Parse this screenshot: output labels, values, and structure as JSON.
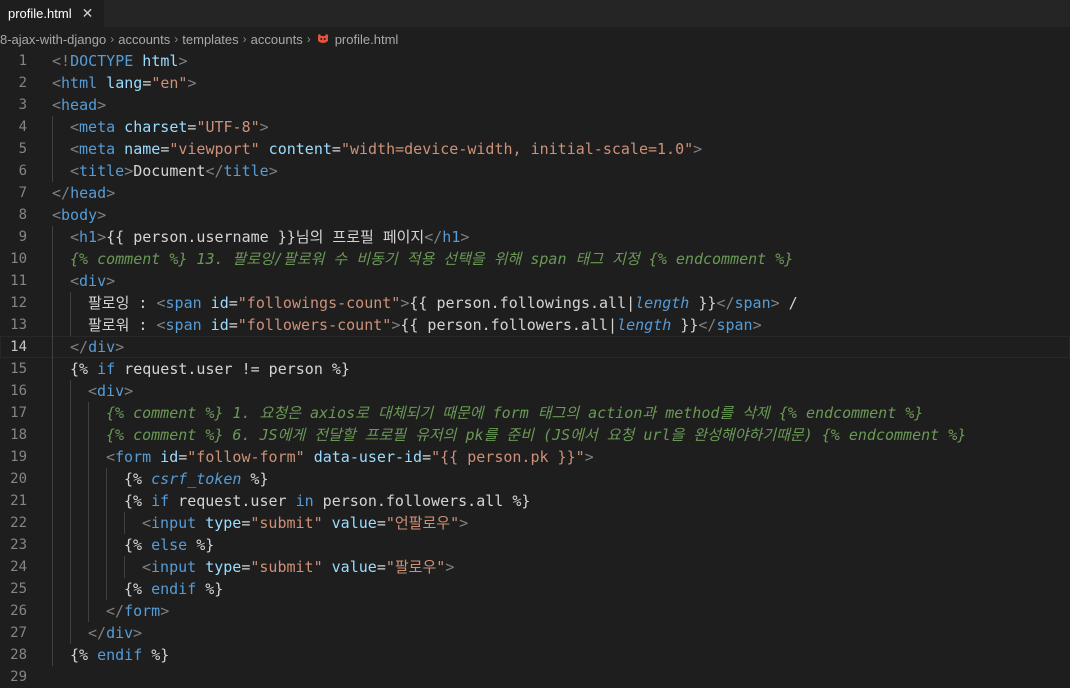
{
  "tab": {
    "name": "profile.html",
    "close": "✕"
  },
  "breadcrumb": [
    "8-ajax-with-django",
    "accounts",
    "templates",
    "accounts",
    "profile.html"
  ],
  "active_line": 14,
  "lines": [
    {
      "n": "1",
      "indent": 0,
      "tokens": [
        [
          "b",
          "<!"
        ],
        [
          "k",
          "DOCTYPE"
        ],
        [
          "a",
          " html"
        ],
        [
          "b",
          ">"
        ]
      ]
    },
    {
      "n": "2",
      "indent": 0,
      "tokens": [
        [
          "b",
          "<"
        ],
        [
          "k",
          "html"
        ],
        [
          "a",
          " lang"
        ],
        [
          "t",
          "="
        ],
        [
          "s",
          "\"en\""
        ],
        [
          "b",
          ">"
        ]
      ]
    },
    {
      "n": "3",
      "indent": 0,
      "tokens": [
        [
          "b",
          "<"
        ],
        [
          "k",
          "head"
        ],
        [
          "b",
          ">"
        ]
      ]
    },
    {
      "n": "4",
      "indent": 1,
      "tokens": [
        [
          "b",
          "<"
        ],
        [
          "k",
          "meta"
        ],
        [
          "a",
          " charset"
        ],
        [
          "t",
          "="
        ],
        [
          "s",
          "\"UTF-8\""
        ],
        [
          "b",
          ">"
        ]
      ]
    },
    {
      "n": "5",
      "indent": 1,
      "tokens": [
        [
          "b",
          "<"
        ],
        [
          "k",
          "meta"
        ],
        [
          "a",
          " name"
        ],
        [
          "t",
          "="
        ],
        [
          "s",
          "\"viewport\""
        ],
        [
          "a",
          " content"
        ],
        [
          "t",
          "="
        ],
        [
          "s",
          "\"width=device-width, initial-scale=1.0\""
        ],
        [
          "b",
          ">"
        ]
      ]
    },
    {
      "n": "6",
      "indent": 1,
      "tokens": [
        [
          "b",
          "<"
        ],
        [
          "k",
          "title"
        ],
        [
          "b",
          ">"
        ],
        [
          "t",
          "Document"
        ],
        [
          "b",
          "</"
        ],
        [
          "k",
          "title"
        ],
        [
          "b",
          ">"
        ]
      ]
    },
    {
      "n": "7",
      "indent": 0,
      "tokens": [
        [
          "b",
          "</"
        ],
        [
          "k",
          "head"
        ],
        [
          "b",
          ">"
        ]
      ]
    },
    {
      "n": "8",
      "indent": 0,
      "tokens": [
        [
          "b",
          "<"
        ],
        [
          "k",
          "body"
        ],
        [
          "b",
          ">"
        ]
      ]
    },
    {
      "n": "9",
      "indent": 1,
      "tokens": [
        [
          "b",
          "<"
        ],
        [
          "k",
          "h1"
        ],
        [
          "b",
          ">"
        ],
        [
          "t",
          "{{ person.username }}님의 프로필 페이지"
        ],
        [
          "b",
          "</"
        ],
        [
          "k",
          "h1"
        ],
        [
          "b",
          ">"
        ]
      ]
    },
    {
      "n": "10",
      "indent": 1,
      "tokens": [
        [
          "c",
          "{% comment %} 13. 팔로잉/팔로워 수 비동기 적용 선택을 위해 span 태그 지정 {% endcomment %}"
        ]
      ]
    },
    {
      "n": "11",
      "indent": 1,
      "tokens": [
        [
          "b",
          "<"
        ],
        [
          "k",
          "div"
        ],
        [
          "b",
          ">"
        ]
      ]
    },
    {
      "n": "12",
      "indent": 2,
      "tokens": [
        [
          "t",
          "팔로잉 : "
        ],
        [
          "b",
          "<"
        ],
        [
          "k",
          "span"
        ],
        [
          "a",
          " id"
        ],
        [
          "t",
          "="
        ],
        [
          "s",
          "\"followings-count\""
        ],
        [
          "b",
          ">"
        ],
        [
          "t",
          "{{ person.followings.all|"
        ],
        [
          "i",
          "length"
        ],
        [
          "t",
          " }}"
        ],
        [
          "b",
          "</"
        ],
        [
          "k",
          "span"
        ],
        [
          "b",
          ">"
        ],
        [
          "t",
          " /"
        ]
      ]
    },
    {
      "n": "13",
      "indent": 2,
      "tokens": [
        [
          "t",
          "팔로워 : "
        ],
        [
          "b",
          "<"
        ],
        [
          "k",
          "span"
        ],
        [
          "a",
          " id"
        ],
        [
          "t",
          "="
        ],
        [
          "s",
          "\"followers-count\""
        ],
        [
          "b",
          ">"
        ],
        [
          "t",
          "{{ person.followers.all|"
        ],
        [
          "i",
          "length"
        ],
        [
          "t",
          " }}"
        ],
        [
          "b",
          "</"
        ],
        [
          "k",
          "span"
        ],
        [
          "b",
          ">"
        ]
      ]
    },
    {
      "n": "14",
      "indent": 1,
      "tokens": [
        [
          "b",
          "</"
        ],
        [
          "k",
          "div"
        ],
        [
          "b",
          ">"
        ]
      ]
    },
    {
      "n": "15",
      "indent": 1,
      "tokens": [
        [
          "t",
          "{% "
        ],
        [
          "d",
          "if"
        ],
        [
          "t",
          " request.user != person %}"
        ]
      ]
    },
    {
      "n": "16",
      "indent": 2,
      "tokens": [
        [
          "b",
          "<"
        ],
        [
          "k",
          "div"
        ],
        [
          "b",
          ">"
        ]
      ]
    },
    {
      "n": "17",
      "indent": 3,
      "tokens": [
        [
          "c",
          "{% comment %} 1. 요청은 axios로 대체되기 때문에 form 태그의 action과 method를 삭제 {% endcomment %}"
        ]
      ]
    },
    {
      "n": "18",
      "indent": 3,
      "tokens": [
        [
          "c",
          "{% comment %} 6. JS에게 전달할 프로필 유저의 pk를 준비 (JS에서 요청 url을 완성해야하기때문) {% endcomment %}"
        ]
      ]
    },
    {
      "n": "19",
      "indent": 3,
      "tokens": [
        [
          "b",
          "<"
        ],
        [
          "k",
          "form"
        ],
        [
          "a",
          " id"
        ],
        [
          "t",
          "="
        ],
        [
          "s",
          "\"follow-form\""
        ],
        [
          "a",
          " data-user-id"
        ],
        [
          "t",
          "="
        ],
        [
          "s",
          "\"{{ person.pk }}\""
        ],
        [
          "b",
          ">"
        ]
      ]
    },
    {
      "n": "20",
      "indent": 4,
      "tokens": [
        [
          "t",
          "{% "
        ],
        [
          "i",
          "csrf_token"
        ],
        [
          "t",
          " %}"
        ]
      ]
    },
    {
      "n": "21",
      "indent": 4,
      "tokens": [
        [
          "t",
          "{% "
        ],
        [
          "d",
          "if"
        ],
        [
          "t",
          " request.user "
        ],
        [
          "d",
          "in"
        ],
        [
          "t",
          " person.followers.all %}"
        ]
      ]
    },
    {
      "n": "22",
      "indent": 5,
      "tokens": [
        [
          "b",
          "<"
        ],
        [
          "k",
          "input"
        ],
        [
          "a",
          " type"
        ],
        [
          "t",
          "="
        ],
        [
          "s",
          "\"submit\""
        ],
        [
          "a",
          " value"
        ],
        [
          "t",
          "="
        ],
        [
          "s",
          "\"언팔로우\""
        ],
        [
          "b",
          ">"
        ]
      ]
    },
    {
      "n": "23",
      "indent": 4,
      "tokens": [
        [
          "t",
          "{% "
        ],
        [
          "d",
          "else"
        ],
        [
          "t",
          " %}"
        ]
      ]
    },
    {
      "n": "24",
      "indent": 5,
      "tokens": [
        [
          "b",
          "<"
        ],
        [
          "k",
          "input"
        ],
        [
          "a",
          " type"
        ],
        [
          "t",
          "="
        ],
        [
          "s",
          "\"submit\""
        ],
        [
          "a",
          " value"
        ],
        [
          "t",
          "="
        ],
        [
          "s",
          "\"팔로우\""
        ],
        [
          "b",
          ">"
        ]
      ]
    },
    {
      "n": "25",
      "indent": 4,
      "tokens": [
        [
          "t",
          "{% "
        ],
        [
          "d",
          "endif"
        ],
        [
          "t",
          " %}"
        ]
      ]
    },
    {
      "n": "26",
      "indent": 3,
      "tokens": [
        [
          "b",
          "</"
        ],
        [
          "k",
          "form"
        ],
        [
          "b",
          ">"
        ]
      ]
    },
    {
      "n": "27",
      "indent": 2,
      "tokens": [
        [
          "b",
          "</"
        ],
        [
          "k",
          "div"
        ],
        [
          "b",
          ">"
        ]
      ]
    },
    {
      "n": "28",
      "indent": 1,
      "tokens": [
        [
          "t",
          "{% "
        ],
        [
          "d",
          "endif"
        ],
        [
          "t",
          " %}"
        ]
      ]
    },
    {
      "n": "29",
      "indent": 0,
      "tokens": []
    }
  ],
  "colors": {
    "tag": "#569cd6",
    "bracket": "#808080",
    "attribute": "#9cdcfe",
    "string": "#ce9178",
    "text": "#d4d4d4",
    "comment": "#6a9955",
    "django_keyword": "#569cd6",
    "background": "#1e1e1e"
  }
}
